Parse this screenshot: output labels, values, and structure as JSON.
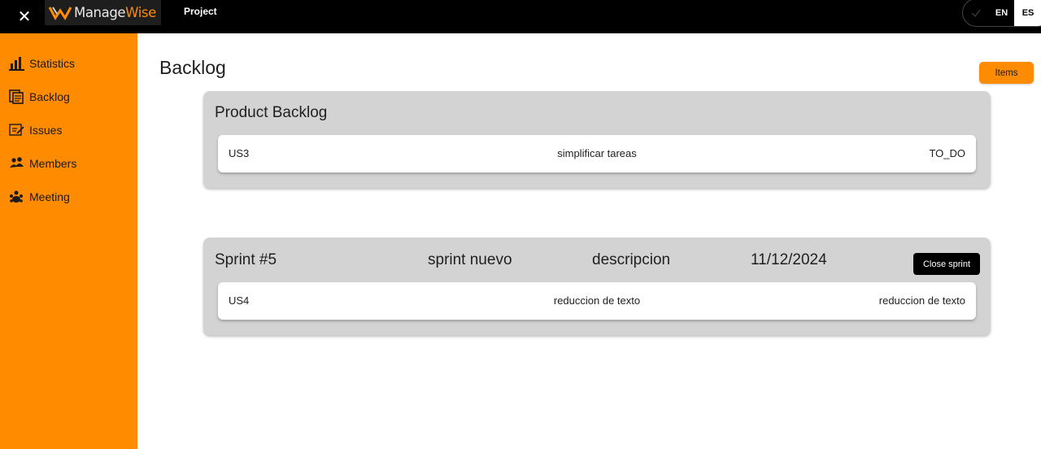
{
  "header": {
    "close_icon": "close-icon",
    "logo_manage": "Manage",
    "logo_wise": "Wise",
    "project_label": "Project",
    "lang_options": [
      "EN",
      "ES"
    ],
    "lang_selected": "ES",
    "accent": "#ff8c00"
  },
  "sidebar": {
    "items": [
      {
        "label": "Statistics",
        "icon": "bar-chart-icon"
      },
      {
        "label": "Backlog",
        "icon": "backlog-icon"
      },
      {
        "label": "Issues",
        "icon": "issues-icon"
      },
      {
        "label": "Members",
        "icon": "members-icon"
      },
      {
        "label": "Meeting",
        "icon": "meeting-icon"
      }
    ]
  },
  "main": {
    "title": "Backlog",
    "items_button": "Items",
    "product_backlog": {
      "title": "Product Backlog",
      "rows": [
        {
          "id": "US3",
          "title": "simplificar tareas",
          "status": "TO_DO"
        }
      ]
    },
    "sprint": {
      "name": "Sprint #5",
      "title": "sprint nuevo",
      "description": "descripcion",
      "date": "11/12/2024",
      "close_button": "Close sprint",
      "rows": [
        {
          "id": "US4",
          "title": "reduccion de texto",
          "status": "reduccion de texto"
        }
      ]
    }
  }
}
